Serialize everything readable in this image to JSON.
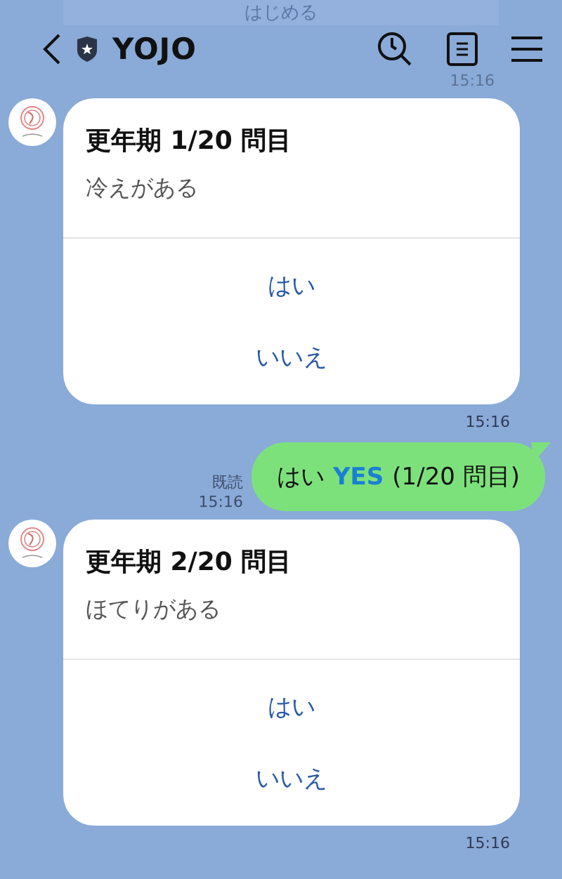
{
  "banner": {
    "label": "はじめる"
  },
  "header": {
    "title": "YOJO"
  },
  "top_time": "15:16",
  "messages": [
    {
      "kind": "card",
      "title": "更年期 1/20 問目",
      "question": "冷えがある",
      "options": [
        "はい",
        "いいえ"
      ],
      "time": "15:16"
    },
    {
      "kind": "user",
      "text": "はい",
      "tag": "YES",
      "suffix": "(1/20 問目)",
      "read": "既読",
      "time": "15:16"
    },
    {
      "kind": "card",
      "title": "更年期 2/20 問目",
      "question": "ほてりがある",
      "options": [
        "はい",
        "いいえ"
      ],
      "time": "15:16"
    }
  ]
}
